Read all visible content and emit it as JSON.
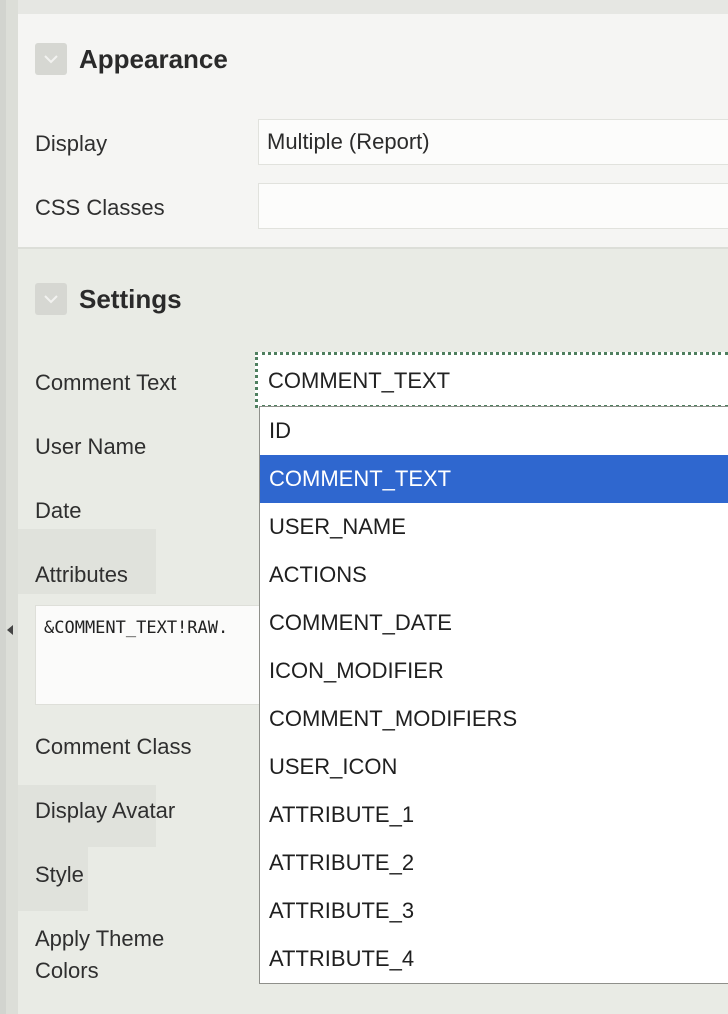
{
  "appearance": {
    "title": "Appearance",
    "display_label": "Display",
    "display_value": "Multiple (Report)",
    "css_label": "CSS Classes",
    "css_value": ""
  },
  "settings": {
    "title": "Settings",
    "labels": {
      "comment_text": "Comment Text",
      "user_name": "User Name",
      "date": "Date",
      "attributes": "Attributes",
      "comment_class": "Comment Class",
      "display_avatar": "Display Avatar",
      "style": "Style",
      "apply_theme_line1": "Apply Theme",
      "apply_theme_line2": "Colors"
    },
    "attributes_value": "&COMMENT_TEXT!RAW."
  },
  "select": {
    "current_value": "COMMENT_TEXT",
    "options": [
      "ID",
      "COMMENT_TEXT",
      "USER_NAME",
      "ACTIONS",
      "COMMENT_DATE",
      "ICON_MODIFIER",
      "COMMENT_MODIFIERS",
      "USER_ICON",
      "ATTRIBUTE_1",
      "ATTRIBUTE_2",
      "ATTRIBUTE_3",
      "ATTRIBUTE_4"
    ],
    "selected_index": 1
  },
  "colors": {
    "highlight": "#2f67cf",
    "focus_outline": "#4f7f5f"
  },
  "icons": {
    "collapse": "chevron-down-icon",
    "rail": "caret-left-icon"
  }
}
